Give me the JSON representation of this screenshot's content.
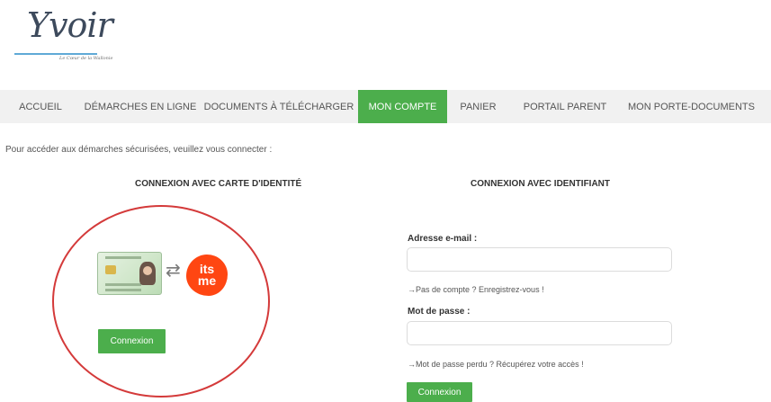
{
  "logo": {
    "name": "Yvoir",
    "tagline": "Le Cœur de la Wallonie"
  },
  "nav": [
    {
      "label": "ACCUEIL",
      "active": false
    },
    {
      "label": "DÉMARCHES EN LIGNE",
      "active": false
    },
    {
      "label": "DOCUMENTS À TÉLÉCHARGER",
      "active": false
    },
    {
      "label": "MON COMPTE",
      "active": true
    },
    {
      "label": "PANIER",
      "active": false
    },
    {
      "label": "PORTAIL PARENT",
      "active": false
    },
    {
      "label": "MON PORTE-DOCUMENTS",
      "active": false
    }
  ],
  "intro": "Pour accéder aux démarches sécurisées, veuillez vous connecter :",
  "id_login": {
    "title": "CONNEXION AVEC CARTE D'IDENTITÉ",
    "itsme_line1": "its",
    "itsme_line2": "me",
    "button": "Connexion"
  },
  "credentials_login": {
    "title": "CONNEXION AVEC IDENTIFIANT",
    "email_label": "Adresse e-mail :",
    "email_value": "",
    "register_link": "→Pas de compte ? Enregistrez-vous !",
    "password_label": "Mot de passe :",
    "password_value": "",
    "recover_link": "→Mot de passe perdu ? Récupérez votre accès !",
    "button": "Connexion"
  },
  "colors": {
    "accent": "#4cae4c",
    "itsme": "#ff4612",
    "highlight_circle": "#d43a3a",
    "nav_bg": "#f1f1f1"
  },
  "icons": [
    "id-card-icon",
    "swap-arrows-icon",
    "itsme-logo-icon"
  ]
}
